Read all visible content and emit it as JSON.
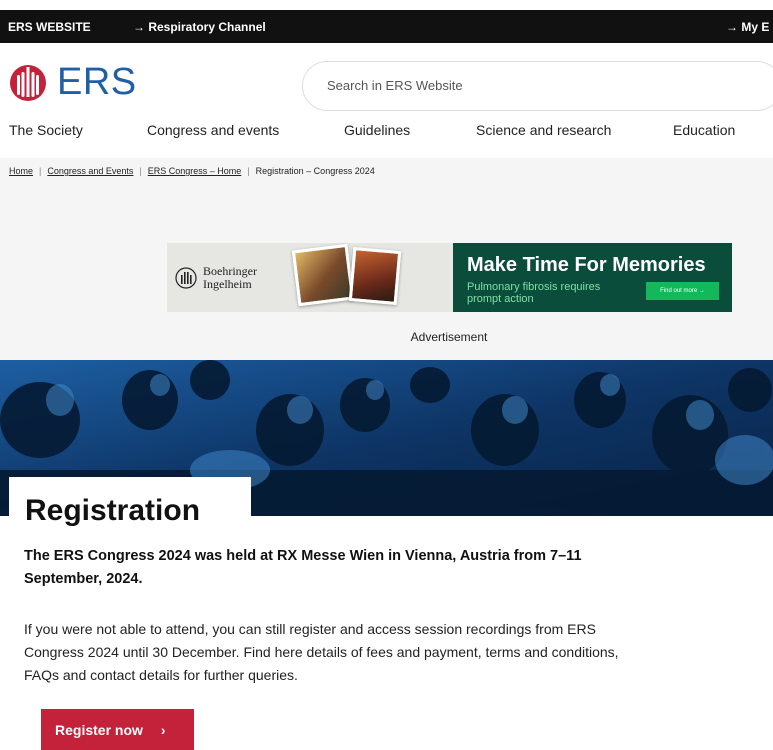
{
  "topbar": {
    "site_label": "ERS WEBSITE",
    "channel_link": "→ Respiratory Channel",
    "my_ers_link": "→ My E"
  },
  "logo": {
    "name": "ERS"
  },
  "search": {
    "placeholder": "Search in ERS Website"
  },
  "nav": {
    "items": [
      "The Society",
      "Congress and events",
      "Guidelines",
      "Science and research",
      "Education"
    ]
  },
  "breadcrumb": {
    "items": [
      "Home",
      "Congress and Events",
      "ERS Congress – Home",
      "Registration – Congress 2024"
    ],
    "separator": "|"
  },
  "advert": {
    "brand": "Boehringer Ingelheim",
    "headline": "Make Time For Memories",
    "subline": "Pulmonary fibrosis requires prompt action",
    "cta": "Find out more →",
    "label": "Advertisement"
  },
  "page": {
    "title": "Registration",
    "lead": "The ERS Congress 2024 was held at RX Messe Wien in Vienna, Austria from 7–11 September, 2024.",
    "body": "If you were not able to attend, you can still register and access session recordings from ERS Congress 2024 until 30 December. Find here details of fees and payment, terms and conditions, FAQs and contact details for further queries.",
    "register_button": "Register now",
    "register_chevron": "›"
  },
  "colors": {
    "brand_blue": "#1f5fa8",
    "brand_red": "#c4213a",
    "ad_green": "#0a4d3b",
    "topbar_bg": "#111111"
  }
}
